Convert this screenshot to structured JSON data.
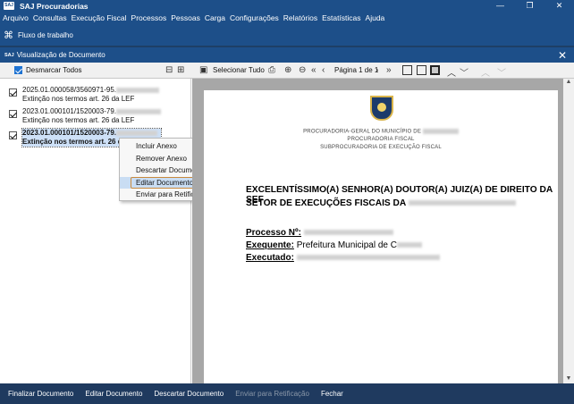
{
  "app": {
    "icon_label": "SAJ",
    "title": "SAJ Procuradorias"
  },
  "window_controls": [
    "—",
    "❐",
    "✕"
  ],
  "menu": [
    "Arquivo",
    "Consultas",
    "Execução Fiscal",
    "Processos",
    "Pessoas",
    "Carga",
    "Configurações",
    "Relatórios",
    "Estatísticas",
    "Ajuda"
  ],
  "toolbar": {
    "workflow_label": "Fluxo de trabalho"
  },
  "dialog": {
    "icon_label": "SAJ",
    "title": "Visualização de Documento",
    "desmarcar_label": "Desmarcar Todos",
    "selecionar_tudo": "Selecionar Tudo",
    "pagina": "Página 1 de 1"
  },
  "documents": [
    {
      "number": "2025.01.000058/3560971-95.",
      "desc": "Extinção nos termos art. 26 da LEF",
      "checked": true
    },
    {
      "number": "2023.01.000101/1520003-79.",
      "desc": "Extinção nos termos art. 26 da LEF",
      "checked": true
    },
    {
      "number": "2023.01.000101/1520003-79.",
      "desc": "Extinção nos termos art. 26 da",
      "checked": true
    }
  ],
  "context_menu": [
    "Incluir Anexo",
    "Remover Anexo",
    "Descartar Documento",
    "Editar Documento",
    "Enviar para Retificação"
  ],
  "preview": {
    "header1": "PROCURADORIA-GERAL DO MUNICÍPIO DE",
    "header2": "PROCURADORIA FISCAL",
    "header3": "SUBPROCURADORIA DE EXECUÇÃO FISCAL",
    "salutation1": "EXCELENTÍSSIMO(A) SENHOR(A) DOUTOR(A) JUIZ(A) DE DIREITO DA SEF -",
    "salutation2": "SETOR DE EXECUÇÕES FISCAIS DA",
    "processo_label": "Processo Nº:",
    "exequente_label": "Exequente:",
    "exequente_value": "Prefeitura Municipal de C",
    "executado_label": "Executado:"
  },
  "bottom": {
    "finalizar": "Finalizar Documento",
    "editar": "Editar Documento",
    "descartar": "Descartar Documento",
    "enviar": "Enviar para Retificação",
    "fechar": "Fechar"
  },
  "colors": {
    "titlebar": "#1d4f89",
    "bottombar": "#1f3a5f",
    "highlight": "#c9ddf3",
    "focus_border": "#c98a3e"
  }
}
